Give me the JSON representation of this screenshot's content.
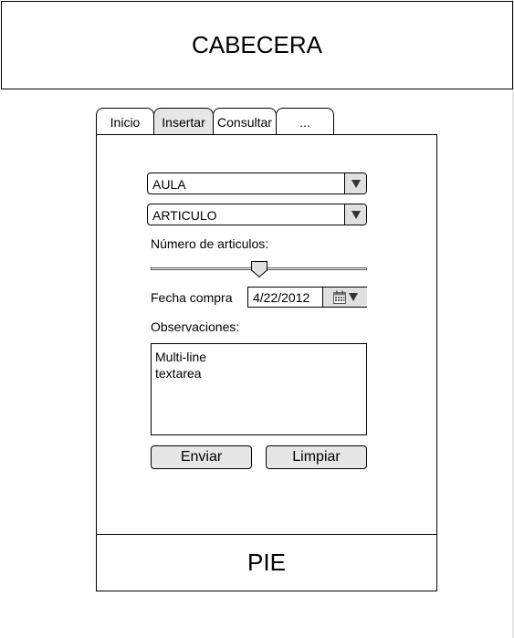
{
  "header": {
    "title": "CABECERA"
  },
  "tabs": [
    {
      "label": "Inicio"
    },
    {
      "label": "Insertar"
    },
    {
      "label": "Consultar"
    },
    {
      "label": "..."
    }
  ],
  "form": {
    "aula_select": {
      "value": "AULA"
    },
    "articulo_select": {
      "value": "ARTICULO"
    },
    "quantity_label": "Número de articulos:",
    "quantity_slider": {
      "value_fraction": 0.5
    },
    "date_label": "Fecha compra",
    "date_value": "4/22/2012",
    "notes_label": "Observaciones:",
    "notes_value": "Multi-line\ntextarea",
    "submit_label": "Enviar",
    "reset_label": "Limpiar"
  },
  "footer": {
    "title": "PIE"
  },
  "icons": {
    "dropdown": "triangle-down-icon",
    "calendar": "calendar-icon"
  }
}
